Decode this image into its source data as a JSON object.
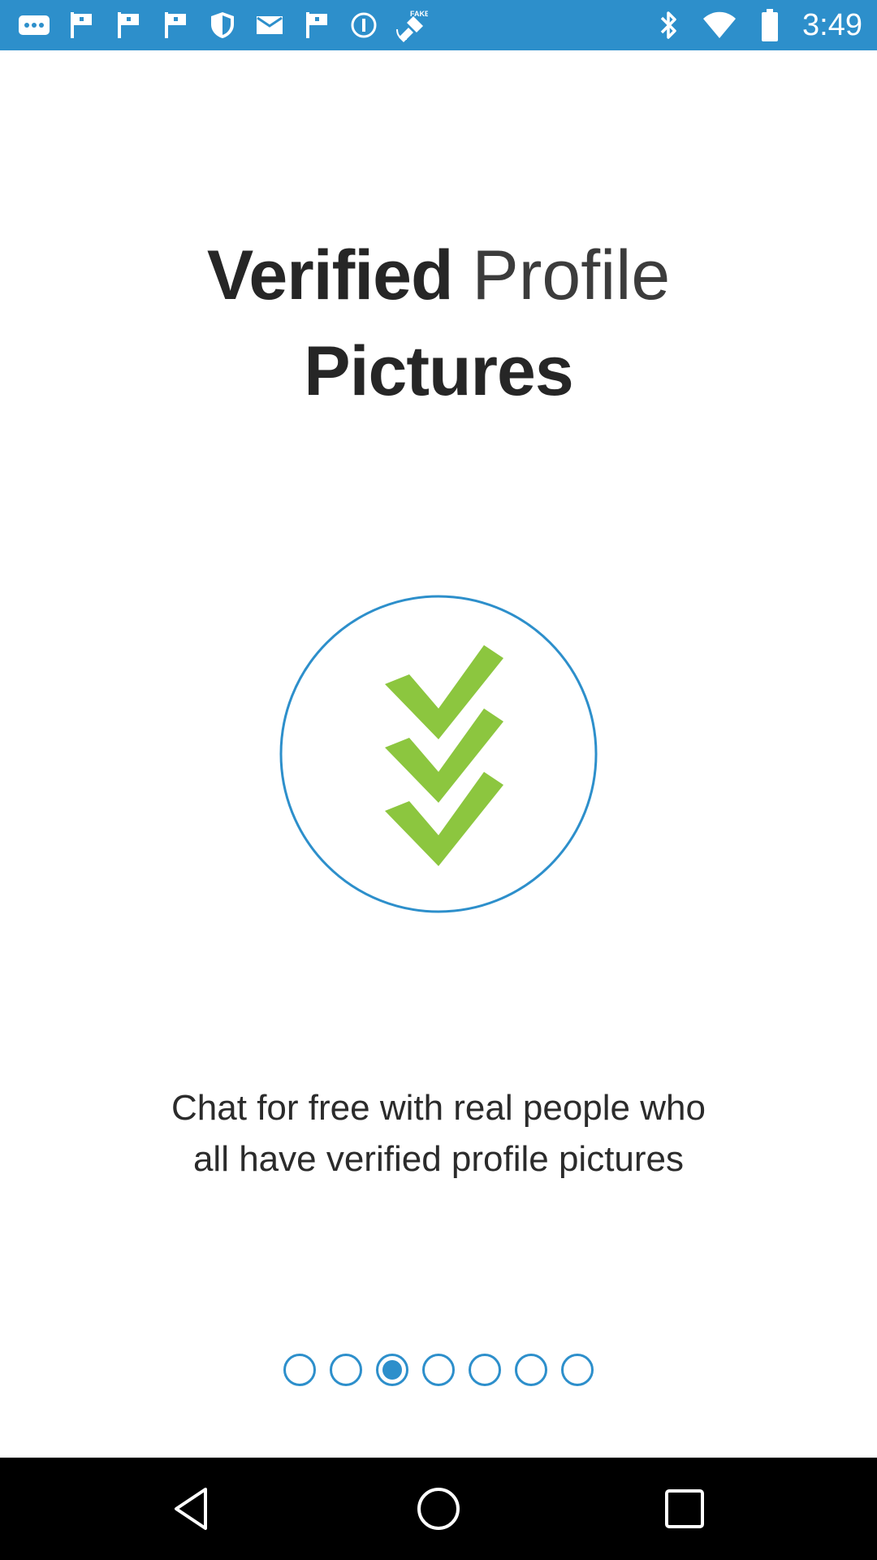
{
  "status_bar": {
    "time": "3:49",
    "icons": [
      "more-icon",
      "flag-icon",
      "flag-icon",
      "flag-icon",
      "shield-icon",
      "mail-icon",
      "flag-icon",
      "info-icon",
      "fake-gps-icon",
      "bluetooth-icon",
      "wifi-icon",
      "battery-icon"
    ],
    "fake_label": "FAKE"
  },
  "onboarding": {
    "title_bold": "Verified",
    "title_light": "Profile",
    "title_line2": "Pictures",
    "subtitle_line1": "Chat for free with real people who",
    "subtitle_line2": "all have verified profile pictures",
    "badge_icon": "triple-check-icon",
    "page_count": 7,
    "current_page": 3
  },
  "colors": {
    "accent": "#2d8fcb",
    "check_green": "#8cc63f",
    "text_dark": "#262626"
  },
  "nav_bar": {
    "buttons": [
      "back-icon",
      "home-icon",
      "recents-icon"
    ]
  }
}
